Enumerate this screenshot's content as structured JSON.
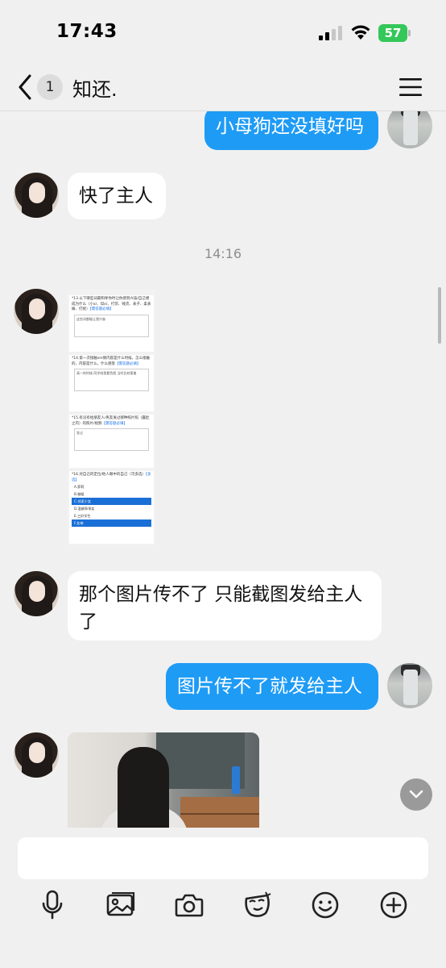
{
  "status_bar": {
    "time": "17:43",
    "battery_level": "57"
  },
  "nav": {
    "back_icon": "chevron-left-icon",
    "unread_count": "1",
    "title": "知还.",
    "menu_icon": "hamburger-menu-icon"
  },
  "messages": [
    {
      "side": "right",
      "type": "text",
      "text": "小母狗还没填好吗"
    },
    {
      "side": "left",
      "type": "text",
      "text": "快了主人"
    },
    {
      "type": "timestamp",
      "text": "14:16"
    },
    {
      "side": "left",
      "type": "image",
      "description_icon": "survey-screenshot"
    },
    {
      "side": "left",
      "type": "text",
      "text": "那个图片传不了 只能截图发给主人了"
    },
    {
      "side": "right",
      "type": "text",
      "text": "图片传不了就发给主人"
    },
    {
      "side": "left",
      "type": "image",
      "description_icon": "photo"
    }
  ],
  "survey": {
    "q13": "*13.以下哪些词最和呼你时让你感到兴奋/自己想成为什么（小x/、母x/、打货、贱货、表子、柔表婊、打扰）",
    "q13_req": "【需答题必填】",
    "q13_answer": "这些词都能让我兴奋",
    "q14": "*14.第一次接触sm情内容是什么时候，怎么接触的，内容是什么，什么感受",
    "q14_req": "【需答题必填】",
    "q14_answer": "高一的时候 同学给我看色图 当时比较害羞",
    "q15": "*15.有没有给朋友人/男友发过那种照片照（露肚之内）的照片/视频",
    "q15_req": "【需答题必填】",
    "q15_answer": "发过",
    "q16": "*16.对自己的定位/他人眼中的自己（可多选）",
    "q16_req": "【多选】",
    "options": [
      {
        "label": "A.萝莉",
        "selected": false
      },
      {
        "label": "B.御姐",
        "selected": false
      },
      {
        "label": "C.邻家少女",
        "selected": true
      },
      {
        "label": "D.温婉乖乖女",
        "selected": false
      },
      {
        "label": "E.三好学生",
        "selected": false
      },
      {
        "label": "F.女神",
        "selected": true
      }
    ]
  },
  "composer": {
    "input_placeholder": "",
    "tools": [
      "microphone-icon",
      "image-icon",
      "camera-icon",
      "sticker-face-icon",
      "smiley-icon",
      "plus-circle-icon"
    ]
  },
  "colors": {
    "background": "#f0f0f0",
    "bubble_blue": "#1e9bf5",
    "bubble_white": "#ffffff",
    "battery_green": "#34c759"
  }
}
